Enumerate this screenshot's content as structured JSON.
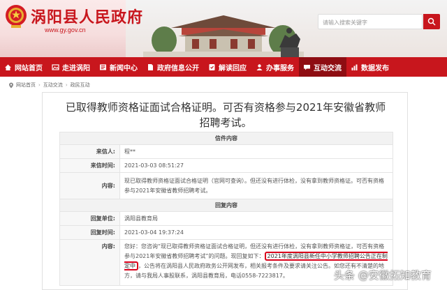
{
  "header": {
    "site_title": "涡阳县人民政府",
    "site_url": "www.gy.gov.cn",
    "search_placeholder": "请输入搜索关键字"
  },
  "nav": {
    "items": [
      {
        "label": "网站首页",
        "icon": "home-icon"
      },
      {
        "label": "走进涡阳",
        "icon": "picture-icon"
      },
      {
        "label": "新闻中心",
        "icon": "news-icon"
      },
      {
        "label": "政府信息公开",
        "icon": "document-icon"
      },
      {
        "label": "解读回应",
        "icon": "interpret-icon"
      },
      {
        "label": "办事服务",
        "icon": "service-icon"
      },
      {
        "label": "互动交流",
        "icon": "chat-icon",
        "active": true
      },
      {
        "label": "数据发布",
        "icon": "chart-icon"
      }
    ]
  },
  "breadcrumb": {
    "items": [
      "网站首页",
      "互动交流",
      "政民互动"
    ]
  },
  "article": {
    "title": "已取得教师资格证面试合格证明。可否有资格参与2021年安徽省教师招聘考试。",
    "letter_section": "信件内容",
    "sender_label": "来信人:",
    "sender": "程**",
    "sent_time_label": "来信时间:",
    "sent_time": "2021-03-03 08:51:27",
    "content_label": "内容:",
    "content": "现已取得教师资格证面试合格证明（官网可查询）。但还没有进行体检，没有拿到教师资格证。可否有资格参与2021年安徽省教师招聘考试。",
    "reply_section": "回复内容",
    "reply_unit_label": "回复单位:",
    "reply_unit": "涡阳县教育局",
    "reply_time_label": "回复时间:",
    "reply_time": "2021-03-04 19:37:24",
    "reply_content_label": "内容:",
    "reply_part1": "您好：您咨询“现已取得教师资格证面试合格证明，但还没有进行体检，没有拿到教师资格证，可否有资格参与2021年安徽省教师招聘考试”的问题。现回复如下：",
    "reply_highlight": "2021年度涡阳县新任中小学教师招聘公告正在制定中",
    "reply_part2": "，公告将在涡阳县人民政府政务公开网发布，相关报考条件及要求请关注公告。如您还有不清楚的地方，请与我局人事股联系，涡阳县教育局，电话0558-7223817。"
  },
  "watermark": "头条 @安徽拓知教育",
  "colors": {
    "brand_red": "#c8161d",
    "nav_active": "#8e0d12"
  }
}
